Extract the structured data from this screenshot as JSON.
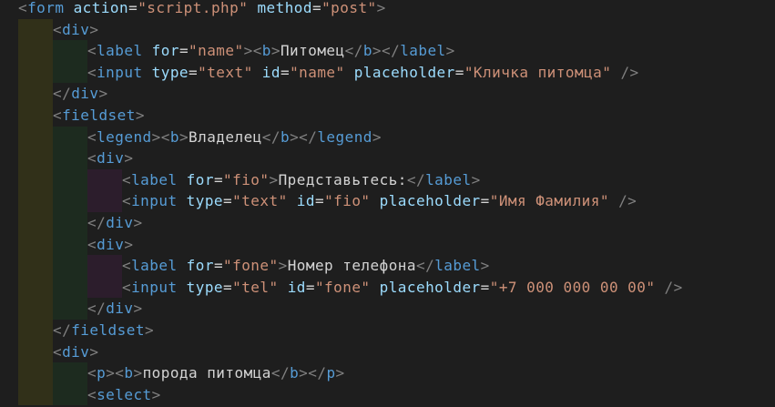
{
  "editor": {
    "language": "html",
    "colors": {
      "background": "#1e1e1e",
      "tag": "#569cd6",
      "attribute": "#9cdcfe",
      "string": "#ce9178",
      "punctuation": "#808080",
      "text": "#d4d4d4",
      "indent_guide_1": "#313019",
      "indent_guide_2": "#1d2b1f",
      "indent_guide_3": "#2c1d2c",
      "indent_guide_4": "#222c30"
    },
    "lines": [
      {
        "depth": 0,
        "tokens": [
          [
            "punc",
            "<"
          ],
          [
            "tag",
            "form"
          ],
          [
            "text",
            " "
          ],
          [
            "attr",
            "action"
          ],
          [
            "eq",
            "="
          ],
          [
            "str",
            "\"script.php\""
          ],
          [
            "text",
            " "
          ],
          [
            "attr",
            "method"
          ],
          [
            "eq",
            "="
          ],
          [
            "str",
            "\"post\""
          ],
          [
            "punc",
            ">"
          ]
        ]
      },
      {
        "depth": 1,
        "tokens": [
          [
            "punc",
            "<"
          ],
          [
            "tag",
            "div"
          ],
          [
            "punc",
            ">"
          ]
        ]
      },
      {
        "depth": 2,
        "tokens": [
          [
            "punc",
            "<"
          ],
          [
            "tag",
            "label"
          ],
          [
            "text",
            " "
          ],
          [
            "attr",
            "for"
          ],
          [
            "eq",
            "="
          ],
          [
            "str",
            "\"name\""
          ],
          [
            "punc",
            ">"
          ],
          [
            "punc",
            "<"
          ],
          [
            "tag",
            "b"
          ],
          [
            "punc",
            ">"
          ],
          [
            "text",
            "Питомец"
          ],
          [
            "punc",
            "</"
          ],
          [
            "tag",
            "b"
          ],
          [
            "punc",
            ">"
          ],
          [
            "punc",
            "</"
          ],
          [
            "tag",
            "label"
          ],
          [
            "punc",
            ">"
          ]
        ]
      },
      {
        "depth": 2,
        "tokens": [
          [
            "punc",
            "<"
          ],
          [
            "tag",
            "input"
          ],
          [
            "text",
            " "
          ],
          [
            "attr",
            "type"
          ],
          [
            "eq",
            "="
          ],
          [
            "str",
            "\"text\""
          ],
          [
            "text",
            " "
          ],
          [
            "attr",
            "id"
          ],
          [
            "eq",
            "="
          ],
          [
            "str",
            "\"name\""
          ],
          [
            "text",
            " "
          ],
          [
            "attr",
            "placeholder"
          ],
          [
            "eq",
            "="
          ],
          [
            "str",
            "\"Кличка питомца\""
          ],
          [
            "text",
            " "
          ],
          [
            "punc",
            "/>"
          ]
        ]
      },
      {
        "depth": 1,
        "tokens": [
          [
            "punc",
            "</"
          ],
          [
            "tag",
            "div"
          ],
          [
            "punc",
            ">"
          ]
        ]
      },
      {
        "depth": 1,
        "tokens": [
          [
            "punc",
            "<"
          ],
          [
            "tag",
            "fieldset"
          ],
          [
            "punc",
            ">"
          ]
        ]
      },
      {
        "depth": 2,
        "tokens": [
          [
            "punc",
            "<"
          ],
          [
            "tag",
            "legend"
          ],
          [
            "punc",
            ">"
          ],
          [
            "punc",
            "<"
          ],
          [
            "tag",
            "b"
          ],
          [
            "punc",
            ">"
          ],
          [
            "text",
            "Владелец"
          ],
          [
            "punc",
            "</"
          ],
          [
            "tag",
            "b"
          ],
          [
            "punc",
            ">"
          ],
          [
            "punc",
            "</"
          ],
          [
            "tag",
            "legend"
          ],
          [
            "punc",
            ">"
          ]
        ]
      },
      {
        "depth": 2,
        "tokens": [
          [
            "punc",
            "<"
          ],
          [
            "tag",
            "div"
          ],
          [
            "punc",
            ">"
          ]
        ]
      },
      {
        "depth": 3,
        "tokens": [
          [
            "punc",
            "<"
          ],
          [
            "tag",
            "label"
          ],
          [
            "text",
            " "
          ],
          [
            "attr",
            "for"
          ],
          [
            "eq",
            "="
          ],
          [
            "str",
            "\"fio\""
          ],
          [
            "punc",
            ">"
          ],
          [
            "text",
            "Представьтесь:"
          ],
          [
            "punc",
            "</"
          ],
          [
            "tag",
            "label"
          ],
          [
            "punc",
            ">"
          ]
        ]
      },
      {
        "depth": 3,
        "tokens": [
          [
            "punc",
            "<"
          ],
          [
            "tag",
            "input"
          ],
          [
            "text",
            " "
          ],
          [
            "attr",
            "type"
          ],
          [
            "eq",
            "="
          ],
          [
            "str",
            "\"text\""
          ],
          [
            "text",
            " "
          ],
          [
            "attr",
            "id"
          ],
          [
            "eq",
            "="
          ],
          [
            "str",
            "\"fio\""
          ],
          [
            "text",
            " "
          ],
          [
            "attr",
            "placeholder"
          ],
          [
            "eq",
            "="
          ],
          [
            "str",
            "\"Имя Фамилия\""
          ],
          [
            "text",
            " "
          ],
          [
            "punc",
            "/>"
          ]
        ]
      },
      {
        "depth": 2,
        "tokens": [
          [
            "punc",
            "</"
          ],
          [
            "tag",
            "div"
          ],
          [
            "punc",
            ">"
          ]
        ]
      },
      {
        "depth": 2,
        "tokens": [
          [
            "punc",
            "<"
          ],
          [
            "tag",
            "div"
          ],
          [
            "punc",
            ">"
          ]
        ]
      },
      {
        "depth": 3,
        "tokens": [
          [
            "punc",
            "<"
          ],
          [
            "tag",
            "label"
          ],
          [
            "text",
            " "
          ],
          [
            "attr",
            "for"
          ],
          [
            "eq",
            "="
          ],
          [
            "str",
            "\"fone\""
          ],
          [
            "punc",
            ">"
          ],
          [
            "text",
            "Номер телефона"
          ],
          [
            "punc",
            "</"
          ],
          [
            "tag",
            "label"
          ],
          [
            "punc",
            ">"
          ]
        ]
      },
      {
        "depth": 3,
        "tokens": [
          [
            "punc",
            "<"
          ],
          [
            "tag",
            "input"
          ],
          [
            "text",
            " "
          ],
          [
            "attr",
            "type"
          ],
          [
            "eq",
            "="
          ],
          [
            "str",
            "\"tel\""
          ],
          [
            "text",
            " "
          ],
          [
            "attr",
            "id"
          ],
          [
            "eq",
            "="
          ],
          [
            "str",
            "\"fone\""
          ],
          [
            "text",
            " "
          ],
          [
            "attr",
            "placeholder"
          ],
          [
            "eq",
            "="
          ],
          [
            "str",
            "\"+7 000 000 00 00\""
          ],
          [
            "text",
            " "
          ],
          [
            "punc",
            "/>"
          ]
        ]
      },
      {
        "depth": 2,
        "tokens": [
          [
            "punc",
            "</"
          ],
          [
            "tag",
            "div"
          ],
          [
            "punc",
            ">"
          ]
        ]
      },
      {
        "depth": 1,
        "tokens": [
          [
            "punc",
            "</"
          ],
          [
            "tag",
            "fieldset"
          ],
          [
            "punc",
            ">"
          ]
        ]
      },
      {
        "depth": 1,
        "tokens": [
          [
            "punc",
            "<"
          ],
          [
            "tag",
            "div"
          ],
          [
            "punc",
            ">"
          ]
        ]
      },
      {
        "depth": 2,
        "tokens": [
          [
            "punc",
            "<"
          ],
          [
            "tag",
            "p"
          ],
          [
            "punc",
            ">"
          ],
          [
            "punc",
            "<"
          ],
          [
            "tag",
            "b"
          ],
          [
            "punc",
            ">"
          ],
          [
            "text",
            "порода питомца"
          ],
          [
            "punc",
            "</"
          ],
          [
            "tag",
            "b"
          ],
          [
            "punc",
            ">"
          ],
          [
            "punc",
            "</"
          ],
          [
            "tag",
            "p"
          ],
          [
            "punc",
            ">"
          ]
        ]
      },
      {
        "depth": 2,
        "tokens": [
          [
            "punc",
            "<"
          ],
          [
            "tag",
            "select"
          ],
          [
            "punc",
            ">"
          ]
        ]
      }
    ]
  }
}
